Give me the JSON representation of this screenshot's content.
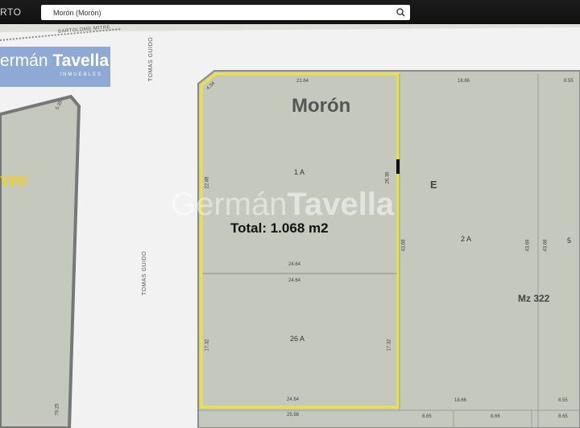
{
  "topbar": {
    "brand_fragment": "RTO",
    "search": {
      "value": "Morón (Morón)",
      "icon": "search-icon"
    }
  },
  "logo": {
    "name_light": "ermán",
    "name_bold": "Tavella",
    "subtitle": "INMUEBLES"
  },
  "watermark": {
    "name_light": "Germán",
    "name_bold": "Tavella"
  },
  "map": {
    "city_label": "Morón",
    "total_label": "Total: 1.068 m2",
    "block_label": "Mz 322",
    "block_letter": "E",
    "station_label": "YPF",
    "streets": [
      "BARTOLOME MITRE",
      "TOMAS GUIDO",
      "TOMAS GUIDO"
    ],
    "lots": [
      "1 A",
      "26 A",
      "2 A",
      "5"
    ],
    "dimensions": [
      "4.34",
      "21.64",
      "18.86",
      "8.55",
      "22.88",
      "26.36",
      "43.68",
      "43.68",
      "43.68",
      "24.64",
      "24.64",
      "17.32",
      "17.32",
      "24.64",
      "18.66",
      "8.55",
      "25.98",
      "8.65",
      "8.66",
      "8.65",
      "79.25",
      "5.35"
    ],
    "colors": {
      "parcel": "#c5c9bd",
      "selected_outline": "#f0e23a",
      "road": "#f2f2f2",
      "station_text": "#f0d21a"
    }
  }
}
